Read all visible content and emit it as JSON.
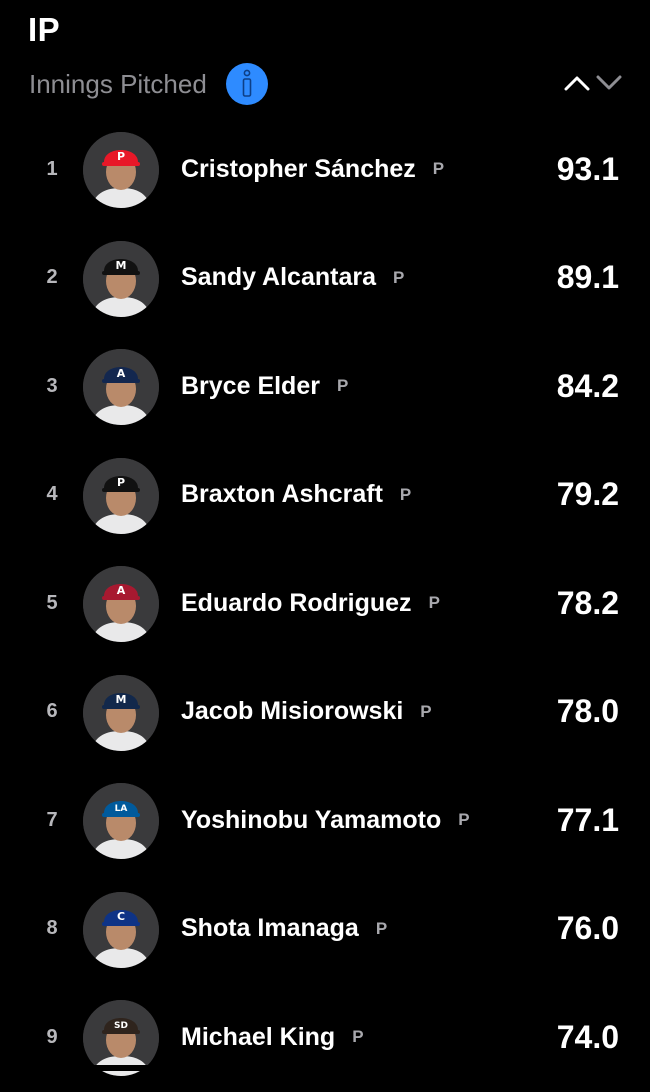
{
  "header": {
    "title": "IP",
    "subtitle": "Innings Pitched",
    "info_icon": "info-icon",
    "sort_icons": [
      "chevron-up-icon",
      "chevron-down-icon"
    ],
    "accent_color": "#2e8bff"
  },
  "players": [
    {
      "rank": "1",
      "name": "Cristopher Sánchez",
      "position": "P",
      "value": "93.1",
      "cap_color": "#e81828",
      "cap_letter": "P"
    },
    {
      "rank": "2",
      "name": "Sandy Alcantara",
      "position": "P",
      "value": "89.1",
      "cap_color": "#111111",
      "cap_letter": "M"
    },
    {
      "rank": "3",
      "name": "Bryce Elder",
      "position": "P",
      "value": "84.2",
      "cap_color": "#13274f",
      "cap_letter": "A"
    },
    {
      "rank": "4",
      "name": "Braxton Ashcraft",
      "position": "P",
      "value": "79.2",
      "cap_color": "#111111",
      "cap_letter": "P"
    },
    {
      "rank": "5",
      "name": "Eduardo Rodriguez",
      "position": "P",
      "value": "78.2",
      "cap_color": "#a71930",
      "cap_letter": "A"
    },
    {
      "rank": "6",
      "name": "Jacob Misiorowski",
      "position": "P",
      "value": "78.0",
      "cap_color": "#12284b",
      "cap_letter": "M"
    },
    {
      "rank": "7",
      "name": "Yoshinobu Yamamoto",
      "position": "P",
      "value": "77.1",
      "cap_color": "#005a9c",
      "cap_letter": "LA"
    },
    {
      "rank": "8",
      "name": "Shota Imanaga",
      "position": "P",
      "value": "76.0",
      "cap_color": "#0e3386",
      "cap_letter": "C"
    },
    {
      "rank": "9",
      "name": "Michael King",
      "position": "P",
      "value": "74.0",
      "cap_color": "#2f241d",
      "cap_letter": "SD"
    }
  ]
}
